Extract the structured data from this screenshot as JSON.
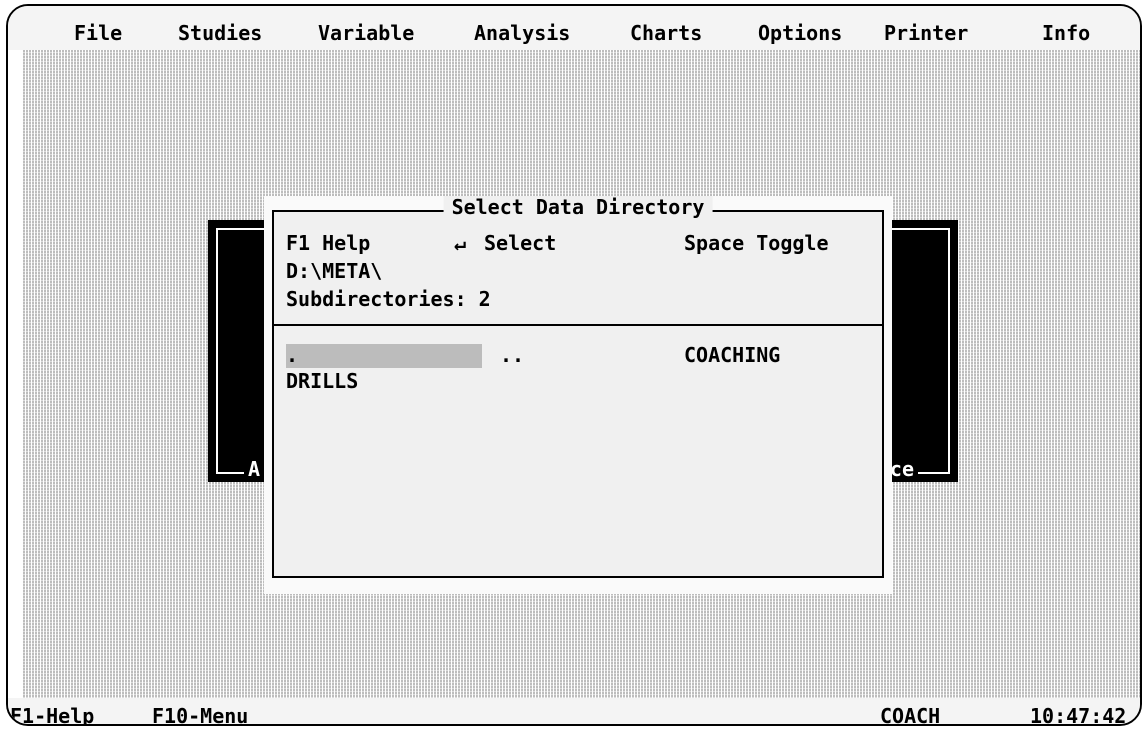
{
  "menu": {
    "items": [
      "File",
      "Studies",
      "Variable",
      "Analysis",
      "Charts",
      "Options",
      "Printer",
      "Info"
    ]
  },
  "background_window": {
    "label_left": "A",
    "label_right": "ce"
  },
  "dialog": {
    "title": "Select Data Directory",
    "help_label": "F1 Help",
    "select_icon": "enter-arrow-icon",
    "select_glyph": "↵",
    "select_label": "Select",
    "toggle_label": "Space Toggle",
    "path": "D:\\META\\",
    "subdirectories_label": "Subdirectories: 2",
    "entries": [
      {
        "name": ".",
        "selected": true
      },
      {
        "name": "..",
        "selected": false
      },
      {
        "name": "COACHING",
        "selected": false
      },
      {
        "name": "DRILLS",
        "selected": false
      }
    ]
  },
  "status": {
    "help": "F1-Help",
    "menu": "F10-Menu",
    "study": "COACH",
    "time": "10:47:42"
  },
  "colors": {
    "selection": "#bcbcbc",
    "background_window": "#000000",
    "dialog": "#f0f0f0"
  }
}
